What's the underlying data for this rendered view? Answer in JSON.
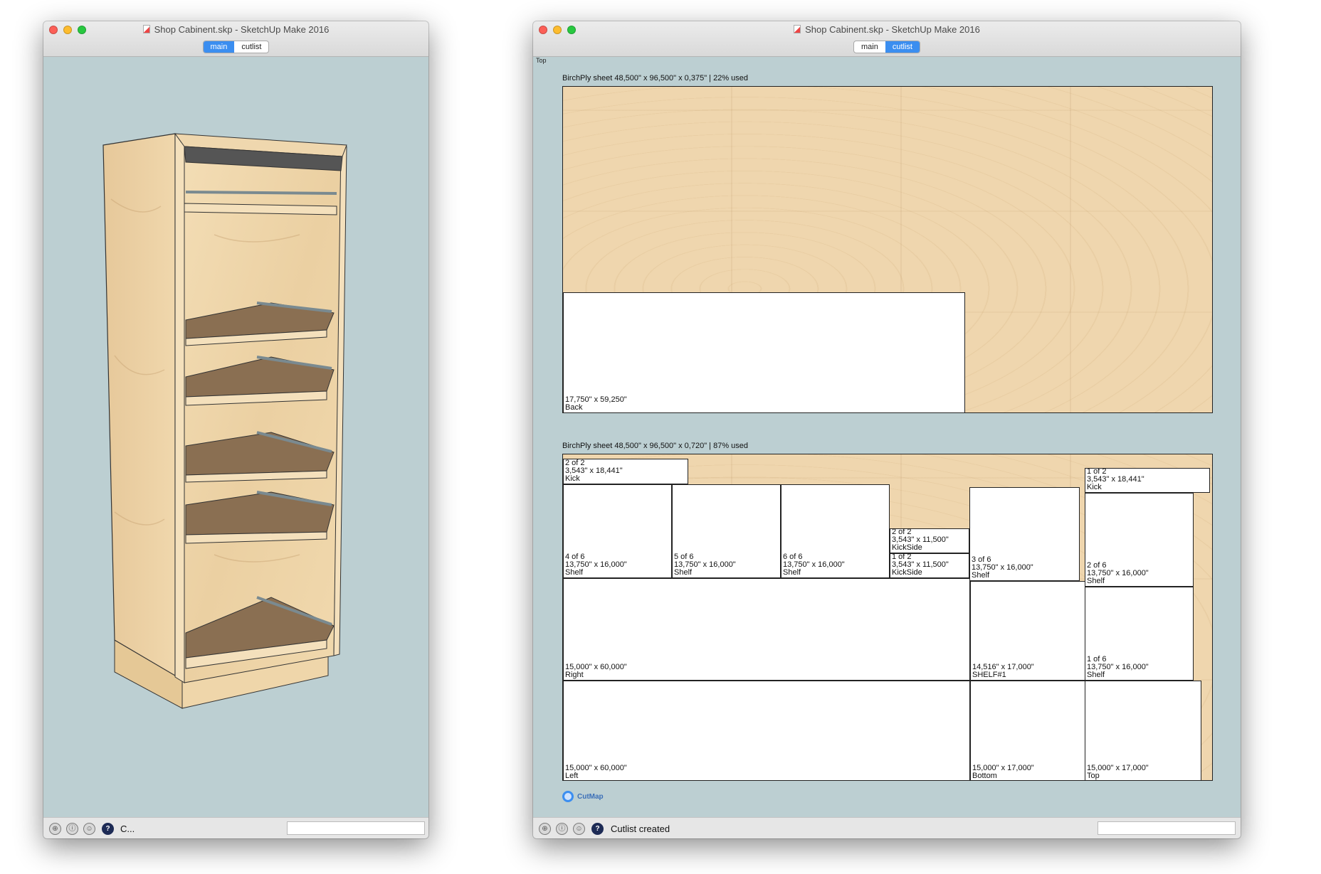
{
  "left_window": {
    "title": "Shop Cabinent.skp - SketchUp Make 2016",
    "tabs": [
      "main",
      "cutlist"
    ],
    "active_tab": "main",
    "status_text": "C...",
    "viewport": {
      "description_icon": "cabinet-model"
    }
  },
  "right_window": {
    "title": "Shop Cabinent.skp - SketchUp Make 2016",
    "tabs": [
      "main",
      "cutlist"
    ],
    "active_tab": "cutlist",
    "view_label": "Top",
    "status_text": "Cutlist created",
    "sheets": [
      {
        "caption": "BirchPly sheet 48,500\" x 96,500\" x 0,375\" | 22% used",
        "parts": [
          {
            "line1": "17,750\" x 59,250\"",
            "line2": "Back"
          }
        ]
      },
      {
        "caption": "BirchPly sheet 48,500\" x 96,500\" x 0,720\" | 87% used",
        "parts": [
          {
            "count": "2 of 2",
            "dims": "3,543\" x 18,441\"",
            "name": "Kick"
          },
          {
            "count": "4 of 6",
            "dims": "13,750\" x 16,000\"",
            "name": "Shelf"
          },
          {
            "count": "5 of 6",
            "dims": "13,750\" x 16,000\"",
            "name": "Shelf"
          },
          {
            "count": "6 of 6",
            "dims": "13,750\" x 16,000\"",
            "name": "Shelf"
          },
          {
            "count": "2 of 2",
            "dims": "3,543\" x 11,500\"",
            "name": "KickSide"
          },
          {
            "count": "1 of 2",
            "dims": "3,543\" x 11,500\"",
            "name": "KickSide"
          },
          {
            "count": "3 of 6",
            "dims": "13,750\" x 16,000\"",
            "name": "Shelf"
          },
          {
            "count": "1 of 2",
            "dims": "3,543\" x 18,441\"",
            "name": "Kick"
          },
          {
            "count": "2 of 6",
            "dims": "13,750\" x 16,000\"",
            "name": "Shelf"
          },
          {
            "count": "",
            "dims": "15,000\" x 60,000\"",
            "name": "Right"
          },
          {
            "count": "",
            "dims": "14,516\" x 17,000\"",
            "name": "SHELF#1"
          },
          {
            "count": "1 of 6",
            "dims": "13,750\" x 16,000\"",
            "name": "Shelf"
          },
          {
            "count": "",
            "dims": "15,000\" x 60,000\"",
            "name": "Left"
          },
          {
            "count": "",
            "dims": "15,000\" x 17,000\"",
            "name": "Bottom"
          },
          {
            "count": "",
            "dims": "15,000\" x 17,000\"",
            "name": "Top"
          }
        ]
      }
    ],
    "logo_text": "CutMap"
  }
}
